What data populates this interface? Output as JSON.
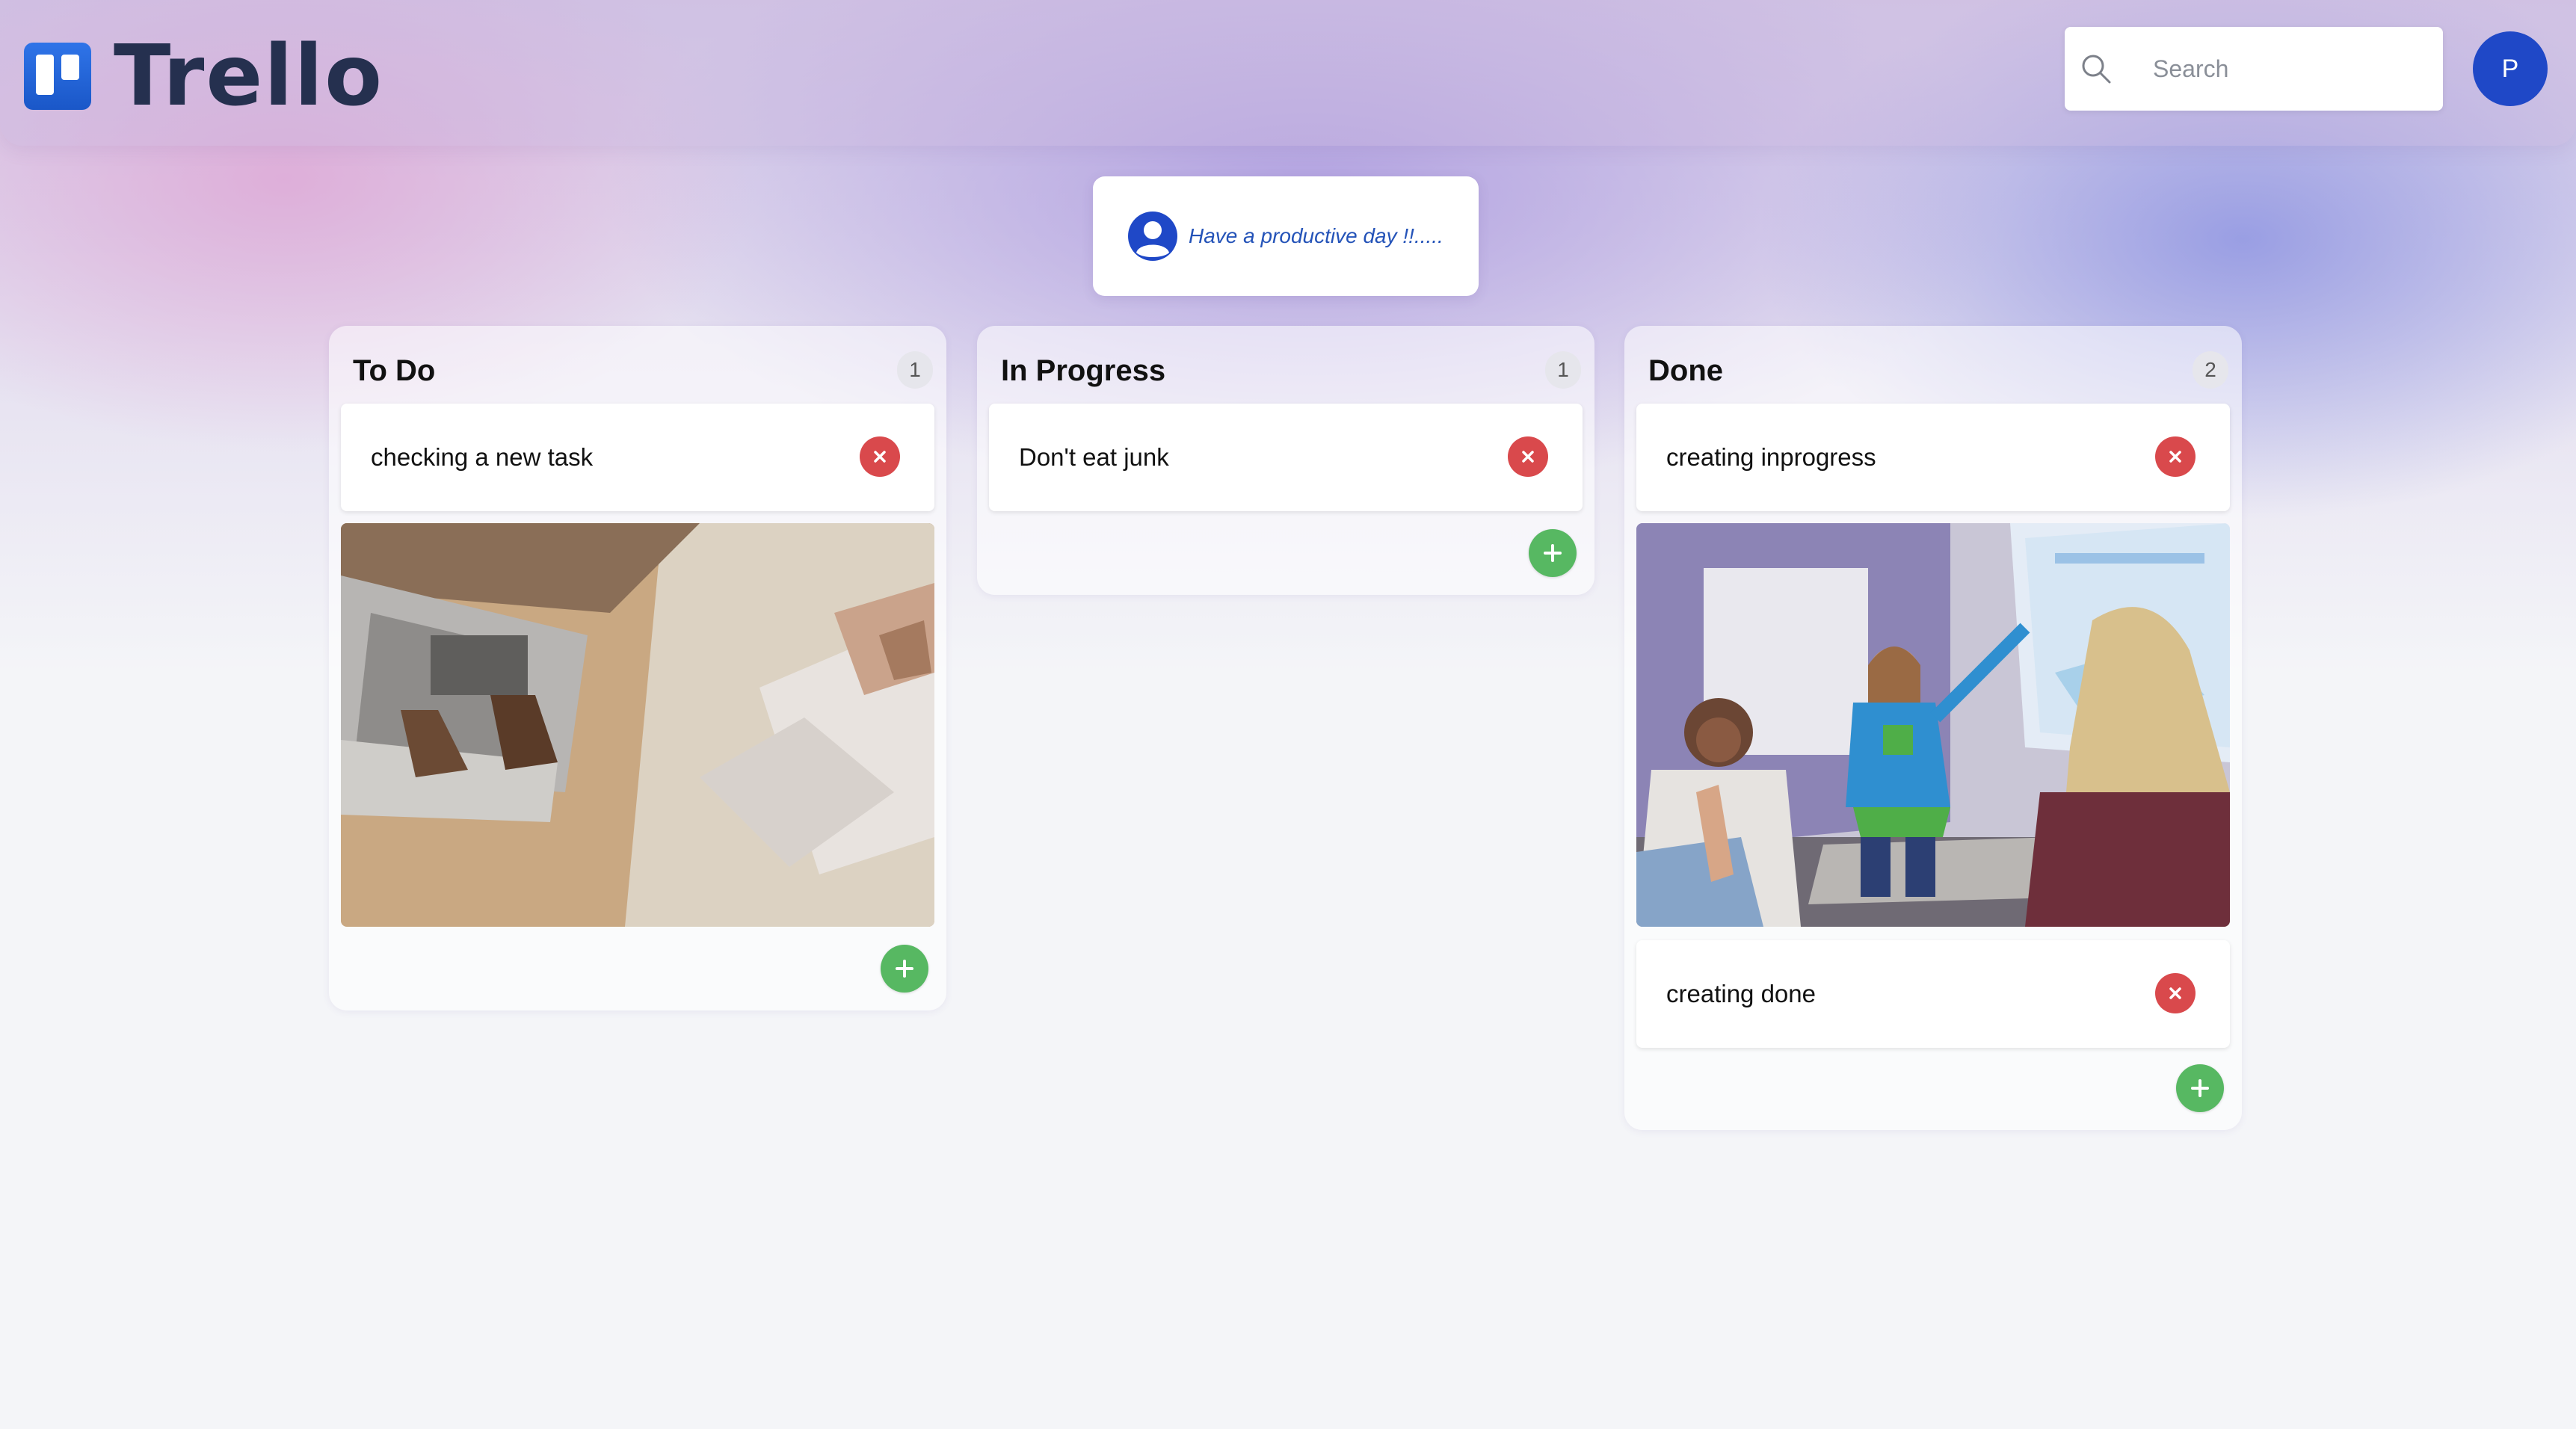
{
  "header": {
    "logo_text": "Trello",
    "search": {
      "placeholder": "Search"
    },
    "avatar_initial": "P"
  },
  "greeting": {
    "message": "Have a productive day !!....."
  },
  "columns": [
    {
      "title": "To Do",
      "count": "1",
      "cards": [
        {
          "text": "checking a new task",
          "has_image": true,
          "image": "laptops-on-table-photo"
        }
      ]
    },
    {
      "title": "In Progress",
      "count": "1",
      "cards": [
        {
          "text": "Don't eat junk",
          "has_image": false
        }
      ]
    },
    {
      "title": "Done",
      "count": "2",
      "cards": [
        {
          "text": "creating inprogress",
          "has_image": true,
          "image": "team-presentation-photo"
        },
        {
          "text": "creating done",
          "has_image": false
        }
      ]
    }
  ],
  "colors": {
    "accent_blue": "#1f48c7",
    "delete_red": "#d9494c",
    "add_green": "#57b862",
    "logo_text": "#25304f"
  },
  "icons": {
    "search": "search-icon",
    "user": "user-circle-icon",
    "delete": "close-icon",
    "add": "plus-icon"
  }
}
